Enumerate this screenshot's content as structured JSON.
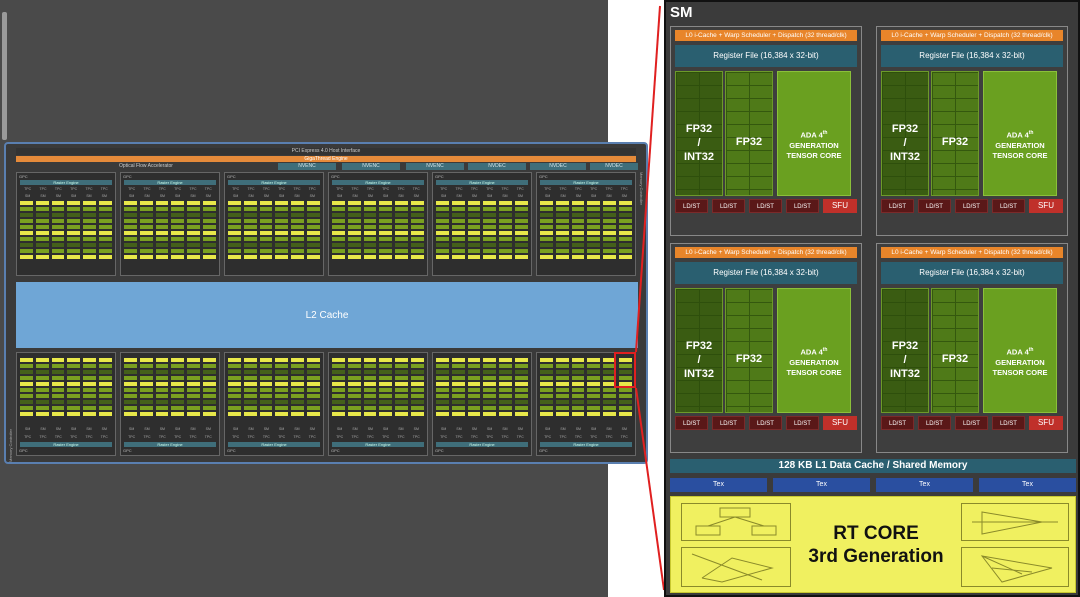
{
  "chip": {
    "pcie_label": "PCI Express 4.0 Host Interface",
    "giga_label": "GigaThread Engine",
    "optical_flow": "Optical Flow Accelerator",
    "engines": [
      "NVENC",
      "NVENC",
      "NVENC",
      "NVDEC",
      "NVDEC",
      "NVDEC"
    ],
    "gpc_label": "GPC",
    "raster_label": "Raster Engine",
    "tpc_label": "TPC",
    "sm_label": "SM",
    "l2_label": "L2 Cache",
    "memory_controller": "Memory Controller"
  },
  "sm": {
    "title": "SM",
    "scheduler": "L0 i-Cache + Warp Scheduler + Dispatch (32 thread/clk)",
    "register_file": "Register File (16,384 x 32-bit)",
    "fp32_int32": [
      "FP32",
      "/",
      "INT32"
    ],
    "fp32": "FP32",
    "tensor": [
      "ADA 4",
      "th",
      "GENERATION",
      "TENSOR CORE"
    ],
    "ldst": "LD/ST",
    "sfu": "SFU",
    "l1": "128 KB L1 Data Cache / Shared Memory",
    "tex": [
      "Tex",
      "Tex",
      "Tex",
      "Tex"
    ],
    "rt_core": [
      "RT CORE",
      "3rd Generation"
    ]
  },
  "colors": {
    "accent_orange": "#e8852a",
    "teal": "#2a5f70",
    "green": "#6aa020",
    "rt_yellow": "#f0f060",
    "highlight_red": "#e02020"
  }
}
